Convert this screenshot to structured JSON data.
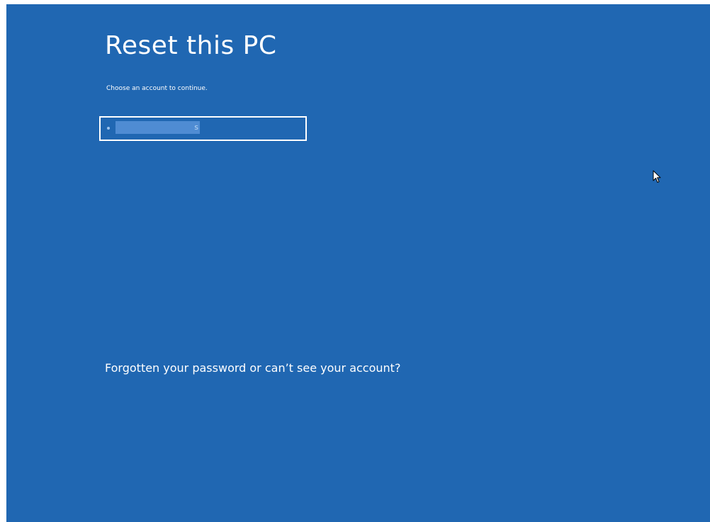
{
  "screen": {
    "title": "Reset this PC",
    "subtitle": "Choose an account to continue."
  },
  "accounts": [
    {
      "name": "s",
      "redacted": true
    }
  ],
  "links": {
    "forgot": "Forgotten your password or can’t see your account?"
  },
  "colors": {
    "background": "#2067b2",
    "text": "#ffffff",
    "selection_border": "#ffffff"
  },
  "icons": {
    "pointer": "mouse-pointer-icon"
  }
}
